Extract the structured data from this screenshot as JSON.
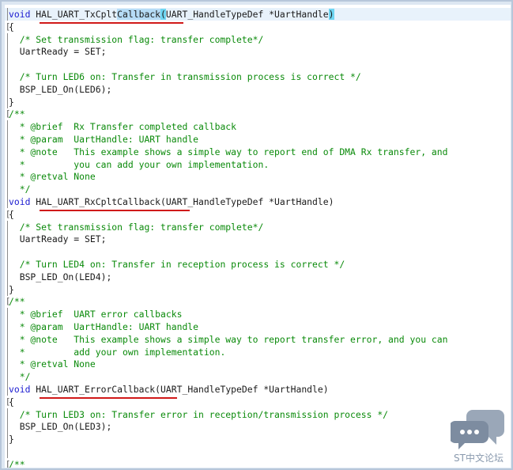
{
  "editor": {
    "lines": [
      {
        "fold": "",
        "parts": [
          {
            "t": "void ",
            "c": "kw"
          },
          {
            "t": "HAL_UART_TxCplt",
            "c": "fn"
          },
          {
            "t": "Callback",
            "c": "sel"
          },
          {
            "t": "(",
            "c": "cur"
          },
          {
            "t": "UART_HandleTypeDef *UartHandle",
            "c": "fn"
          },
          {
            "t": ")",
            "c": "cur"
          }
        ]
      },
      {
        "fold": "[",
        "parts": [
          {
            "t": "{",
            "c": ""
          }
        ]
      },
      {
        "fold": "",
        "parts": [
          {
            "t": "  /* Set transmission flag: transfer complete*/",
            "c": "cm"
          }
        ]
      },
      {
        "fold": "",
        "parts": [
          {
            "t": "  UartReady = SET;",
            "c": ""
          }
        ]
      },
      {
        "fold": "",
        "parts": [
          {
            "t": "",
            "c": ""
          }
        ]
      },
      {
        "fold": "",
        "parts": [
          {
            "t": "  /* Turn LED6 on: Transfer in transmission process is correct */",
            "c": "cm"
          }
        ]
      },
      {
        "fold": "",
        "parts": [
          {
            "t": "  BSP_LED_On(LED6);",
            "c": ""
          }
        ]
      },
      {
        "fold": "",
        "parts": [
          {
            "t": "}",
            "c": ""
          }
        ]
      },
      {
        "fold": "[",
        "parts": [
          {
            "t": "/**",
            "c": "cm"
          }
        ]
      },
      {
        "fold": "",
        "parts": [
          {
            "t": "  * @brief  Rx Transfer completed callback",
            "c": "cm"
          }
        ]
      },
      {
        "fold": "",
        "parts": [
          {
            "t": "  * @param  UartHandle: UART handle",
            "c": "cm"
          }
        ]
      },
      {
        "fold": "",
        "parts": [
          {
            "t": "  * @note   This example shows a simple way to report end of DMA Rx transfer, and",
            "c": "cm"
          }
        ]
      },
      {
        "fold": "",
        "parts": [
          {
            "t": "  *         you can add your own implementation.",
            "c": "cm"
          }
        ]
      },
      {
        "fold": "",
        "parts": [
          {
            "t": "  * @retval None",
            "c": "cm"
          }
        ]
      },
      {
        "fold": "",
        "parts": [
          {
            "t": "  */",
            "c": "cm"
          }
        ]
      },
      {
        "fold": "",
        "parts": [
          {
            "t": "void ",
            "c": "kw"
          },
          {
            "t": "HAL_UART_RxCpltCallback(UART_HandleTypeDef *UartHandle)",
            "c": ""
          }
        ]
      },
      {
        "fold": "[",
        "parts": [
          {
            "t": "{",
            "c": ""
          }
        ]
      },
      {
        "fold": "",
        "parts": [
          {
            "t": "  /* Set transmission flag: transfer complete*/",
            "c": "cm"
          }
        ]
      },
      {
        "fold": "",
        "parts": [
          {
            "t": "  UartReady = SET;",
            "c": ""
          }
        ]
      },
      {
        "fold": "",
        "parts": [
          {
            "t": "",
            "c": ""
          }
        ]
      },
      {
        "fold": "",
        "parts": [
          {
            "t": "  /* Turn LED4 on: Transfer in reception process is correct */",
            "c": "cm"
          }
        ]
      },
      {
        "fold": "",
        "parts": [
          {
            "t": "  BSP_LED_On(LED4);",
            "c": ""
          }
        ]
      },
      {
        "fold": "",
        "parts": [
          {
            "t": "}",
            "c": ""
          }
        ]
      },
      {
        "fold": "[",
        "parts": [
          {
            "t": "/**",
            "c": "cm"
          }
        ]
      },
      {
        "fold": "",
        "parts": [
          {
            "t": "  * @brief  UART error callbacks",
            "c": "cm"
          }
        ]
      },
      {
        "fold": "",
        "parts": [
          {
            "t": "  * @param  UartHandle: UART handle",
            "c": "cm"
          }
        ]
      },
      {
        "fold": "",
        "parts": [
          {
            "t": "  * @note   This example shows a simple way to report transfer error, and you can",
            "c": "cm"
          }
        ]
      },
      {
        "fold": "",
        "parts": [
          {
            "t": "  *         add your own implementation.",
            "c": "cm"
          }
        ]
      },
      {
        "fold": "",
        "parts": [
          {
            "t": "  * @retval None",
            "c": "cm"
          }
        ]
      },
      {
        "fold": "",
        "parts": [
          {
            "t": "  */",
            "c": "cm"
          }
        ]
      },
      {
        "fold": "",
        "parts": [
          {
            "t": "void ",
            "c": "kw"
          },
          {
            "t": "HAL_UART_ErrorCallback(UART_HandleTypeDef *UartHandle)",
            "c": ""
          }
        ]
      },
      {
        "fold": "[",
        "parts": [
          {
            "t": "{",
            "c": ""
          }
        ]
      },
      {
        "fold": "",
        "parts": [
          {
            "t": "  /* Turn LED3 on: Transfer error in reception/transmission process */",
            "c": "cm"
          }
        ]
      },
      {
        "fold": "",
        "parts": [
          {
            "t": "  BSP_LED_On(LED3);",
            "c": ""
          }
        ]
      },
      {
        "fold": "",
        "parts": [
          {
            "t": "}",
            "c": ""
          }
        ]
      },
      {
        "fold": "",
        "parts": [
          {
            "t": "",
            "c": ""
          }
        ]
      },
      {
        "fold": "[",
        "parts": [
          {
            "t": "/**",
            "c": "cm"
          }
        ]
      }
    ]
  },
  "watermark": {
    "icon": "chat-bubbles-icon",
    "label": "ST中文论坛"
  },
  "colors": {
    "keyword": "#1b1bd0",
    "comment": "#0a8a0a",
    "selection": "#b6dcf6",
    "bracket_match": "#6fd6f2",
    "underline": "#d01919"
  }
}
